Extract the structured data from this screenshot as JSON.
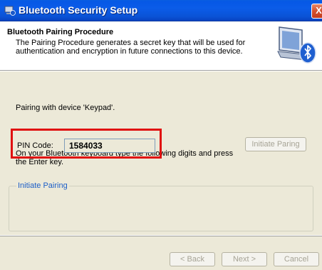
{
  "window": {
    "title": "Bluetooth Security Setup",
    "close_glyph": "X"
  },
  "header": {
    "title": "Bluetooth Pairing Procedure",
    "description": "The Pairing Procedure generates a secret key that will be used for authentication and encryption in future connections to this device.",
    "icon": "bluetooth-computer-icon"
  },
  "body": {
    "pairing_text": "Pairing with device 'Keypad'.",
    "instruction_text": "On your Bluetooth keyboard type the following digits and press the Enter key.",
    "group": {
      "legend": "Initiate Pairing",
      "pin_label": "PIN Code:",
      "pin_value": "1584033",
      "initiate_button": "Initiate Paring"
    }
  },
  "footer": {
    "back_button": "< Back",
    "next_button": "Next >",
    "cancel_button": "Cancel"
  },
  "colors": {
    "titlebar": "#0a5ee0",
    "dialog_bg": "#ece9d8",
    "highlight": "#e01010",
    "legend": "#1c5ec7"
  }
}
